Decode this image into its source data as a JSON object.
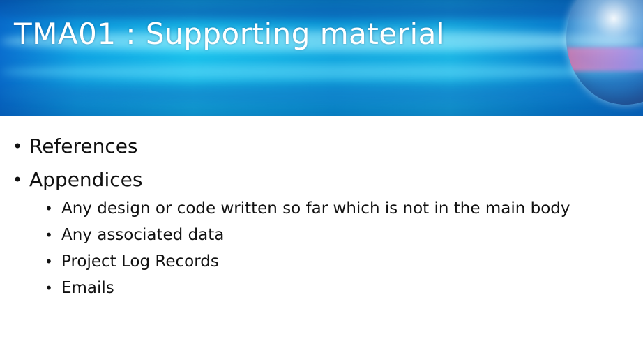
{
  "slide": {
    "title": "TMA01 : Supporting material",
    "items": [
      {
        "label": "References"
      },
      {
        "label": "Appendices",
        "subitems": [
          {
            "label": "Any design or code written so far which is not in the main body"
          },
          {
            "label": "Any associated data"
          },
          {
            "label": "Project Log Records"
          },
          {
            "label": "Emails"
          }
        ]
      }
    ],
    "colors": {
      "banner_primary": "#11a7e6",
      "title_text": "#ffffff",
      "body_text": "#111111"
    },
    "icons": {
      "banner_decoration": "glass-globe-icon",
      "bullet": "bullet-dot-icon"
    }
  }
}
